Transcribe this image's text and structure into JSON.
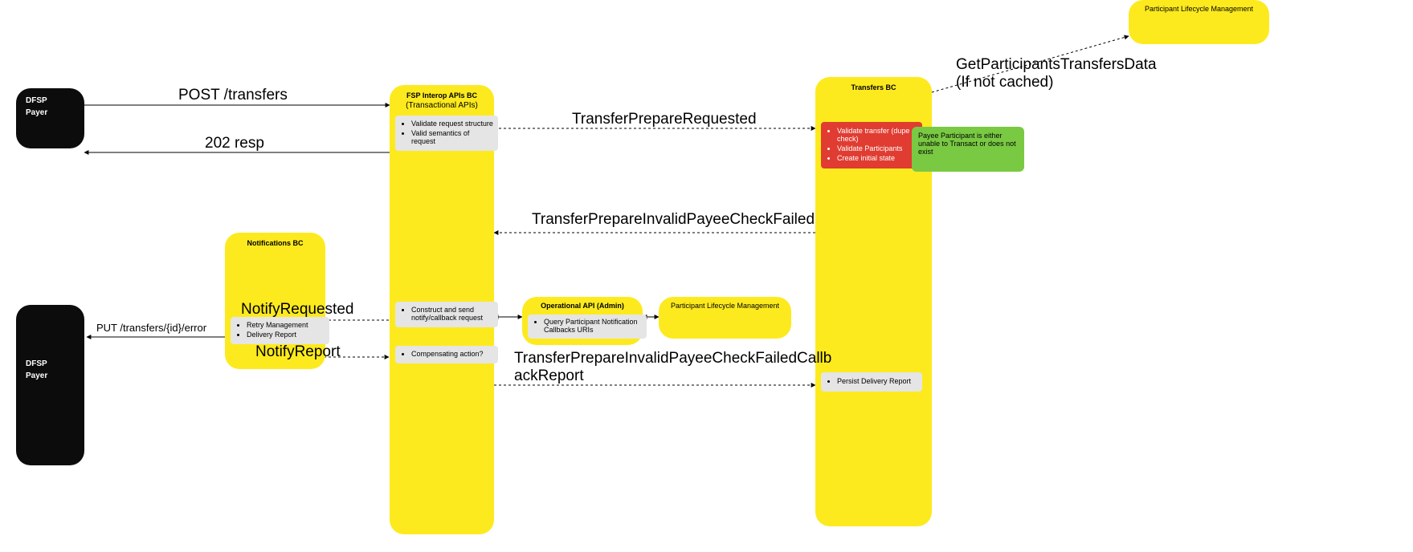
{
  "dfsp_payer1": {
    "line1": "DFSP",
    "line2": "Payer"
  },
  "dfsp_payer2": {
    "line1": "DFSP",
    "line2": "Payer"
  },
  "fsp_bc": {
    "title": "FSP Interop APIs BC",
    "subtitle": "(Transactional APIs)",
    "task_validate": {
      "item1": "Validate request structure",
      "item2": "Valid semantics of request"
    },
    "task_construct": {
      "item1": "Construct and send notify/callback request"
    },
    "task_compensate": {
      "item1": "Compensating action?"
    }
  },
  "transfers_bc": {
    "title": "Transfers BC",
    "task_validate_transfer": {
      "item1": "Validate transfer (dupe check)",
      "item2": "Validate Participants",
      "item3": "Create initial state"
    },
    "task_persist": {
      "item1": "Persist Delivery Report"
    }
  },
  "notifications_bc": {
    "title": "Notifications BC",
    "tasks": {
      "item1": "Retry Management",
      "item2": "Delivery Report"
    }
  },
  "op_api": {
    "title": "Operational API (Admin)",
    "tasks": {
      "item1": "Query Participant Notification Callbacks URIs"
    }
  },
  "plm_small": {
    "title": "Participant Lifecycle Management"
  },
  "plm_large": {
    "title": "Participant Lifecycle Management"
  },
  "payee_note": {
    "text": "Payee Participant is either\nunable to Transact or\ndoes not exist"
  },
  "labels": {
    "post_transfers": "POST /transfers",
    "resp_202": "202 resp",
    "transfer_prepare_requested": "TransferPrepareRequested",
    "get_participants": "GetParticipantsTransfersData\n(If not cached)",
    "transfer_prepare_invalid": "TransferPrepareInvalidPayeeCheckFailed",
    "notify_requested": "NotifyRequested",
    "notify_report": "NotifyReport",
    "put_transfers_error": "PUT /transfers/{id}/error",
    "callback_report": "TransferPrepareInvalidPayeeCheckFailedCallb\nackReport"
  }
}
